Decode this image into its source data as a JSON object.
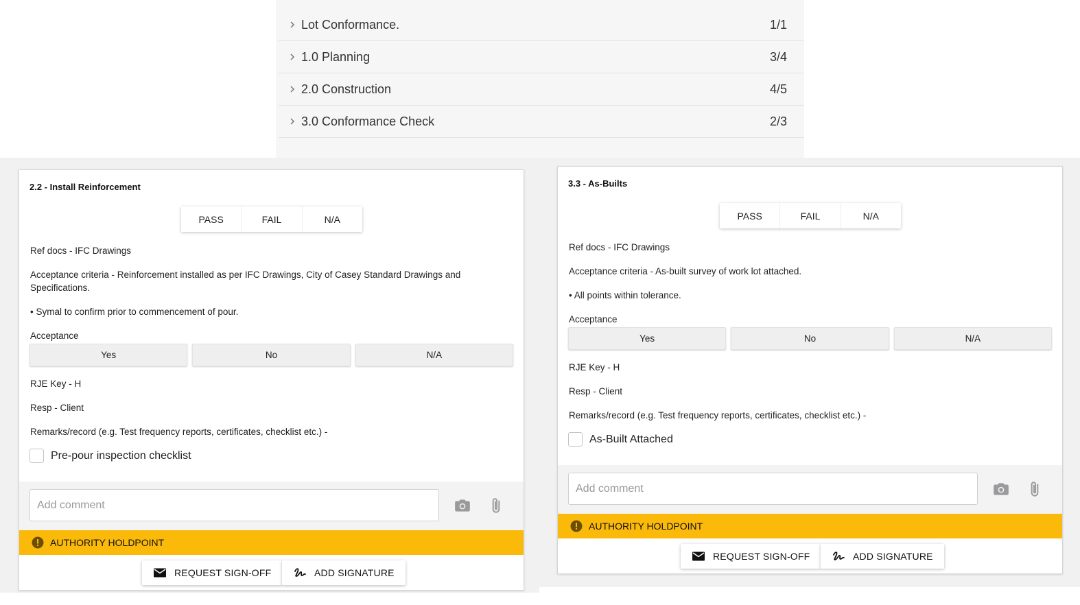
{
  "sections": [
    {
      "title": "Lot Conformance.",
      "count": "1/1"
    },
    {
      "title": "1.0 Planning",
      "count": "3/4"
    },
    {
      "title": "2.0 Construction",
      "count": "4/5"
    },
    {
      "title": "3.0 Conformance Check",
      "count": "2/3"
    }
  ],
  "cards": [
    {
      "title": "2.2 - Install Reinforcement",
      "result_options": [
        "PASS",
        "FAIL",
        "N/A"
      ],
      "ref_docs": "Ref docs - IFC Drawings",
      "criteria_line1": "Acceptance criteria - Reinforcement installed as per IFC Drawings, City of Casey Standard Drawings and",
      "criteria_line2": "Specifications.",
      "bullet": "• Symal to confirm prior to commencement of pour.",
      "acceptance_label": "Acceptance",
      "acceptance_options": [
        "Yes",
        "No",
        "N/A"
      ],
      "rje_key": "RJE Key - H",
      "resp": "Resp - Client",
      "remarks": "Remarks/record (e.g. Test frequency reports, certificates, checklist etc.) -",
      "checkbox_label": "Pre-pour inspection checklist",
      "comment_placeholder": "Add comment",
      "holdpoint_label": "AUTHORITY HOLDPOINT",
      "request_signoff_label": "REQUEST SIGN-OFF",
      "add_signature_label": "ADD SIGNATURE"
    },
    {
      "title": "3.3 - As-Builts",
      "result_options": [
        "PASS",
        "FAIL",
        "N/A"
      ],
      "ref_docs": "Ref docs - IFC Drawings",
      "criteria_line1": "Acceptance criteria - As-built survey of work lot attached.",
      "bullet": "• All points within tolerance.",
      "acceptance_label": "Acceptance",
      "acceptance_options": [
        "Yes",
        "No",
        "N/A"
      ],
      "rje_key": "RJE Key - H",
      "resp": "Resp - Client",
      "remarks": "Remarks/record (e.g. Test frequency reports, certificates, checklist etc.) -",
      "checkbox_label": "As-Built Attached",
      "comment_placeholder": "Add comment",
      "holdpoint_label": "AUTHORITY HOLDPOINT",
      "request_signoff_label": "REQUEST SIGN-OFF",
      "add_signature_label": "ADD SIGNATURE"
    }
  ],
  "colors": {
    "holdpoint": "#fbb90a",
    "background": "#f1f1f2",
    "card": "#ffffff"
  },
  "icons": {
    "chevron": "chevron-right-icon",
    "camera": "camera-icon",
    "attach": "paperclip-icon",
    "holdpoint": "exclamation-circle-icon",
    "mail": "mail-icon",
    "signature": "signature-icon"
  }
}
